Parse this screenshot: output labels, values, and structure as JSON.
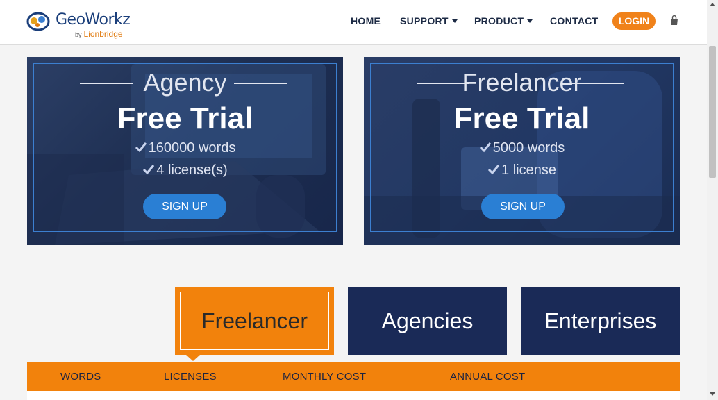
{
  "header": {
    "logo_word": "GeoWorkz",
    "logo_by": "by",
    "logo_brand": "Lionbridge",
    "nav": [
      {
        "label": "HOME",
        "has_dropdown": false
      },
      {
        "label": "SUPPORT",
        "has_dropdown": true
      },
      {
        "label": "PRODUCT",
        "has_dropdown": true
      },
      {
        "label": "CONTACT",
        "has_dropdown": false
      }
    ],
    "login_label": "LOGIN",
    "cart_icon": "shopping-bag-icon"
  },
  "trials": [
    {
      "kind": "Agency",
      "title": "Free Trial",
      "features": [
        "160000 words",
        "4 license(s)"
      ],
      "cta": "SIGN UP"
    },
    {
      "kind": "Freelancer",
      "title": "Free Trial",
      "features": [
        "5000 words",
        "1 license"
      ],
      "cta": "SIGN UP"
    }
  ],
  "segments": {
    "items": [
      "Freelancer",
      "Agencies",
      "Enterprises"
    ],
    "selected": "Freelancer"
  },
  "pricing_table": {
    "columns": [
      "WORDS",
      "LICENSES",
      "MONTHLY COST",
      "ANNUAL COST"
    ]
  },
  "colors": {
    "accent_orange": "#f2820c",
    "navy": "#1a2a57",
    "button_blue": "#2a7fd4",
    "brand_blue": "#1a3e7a"
  }
}
